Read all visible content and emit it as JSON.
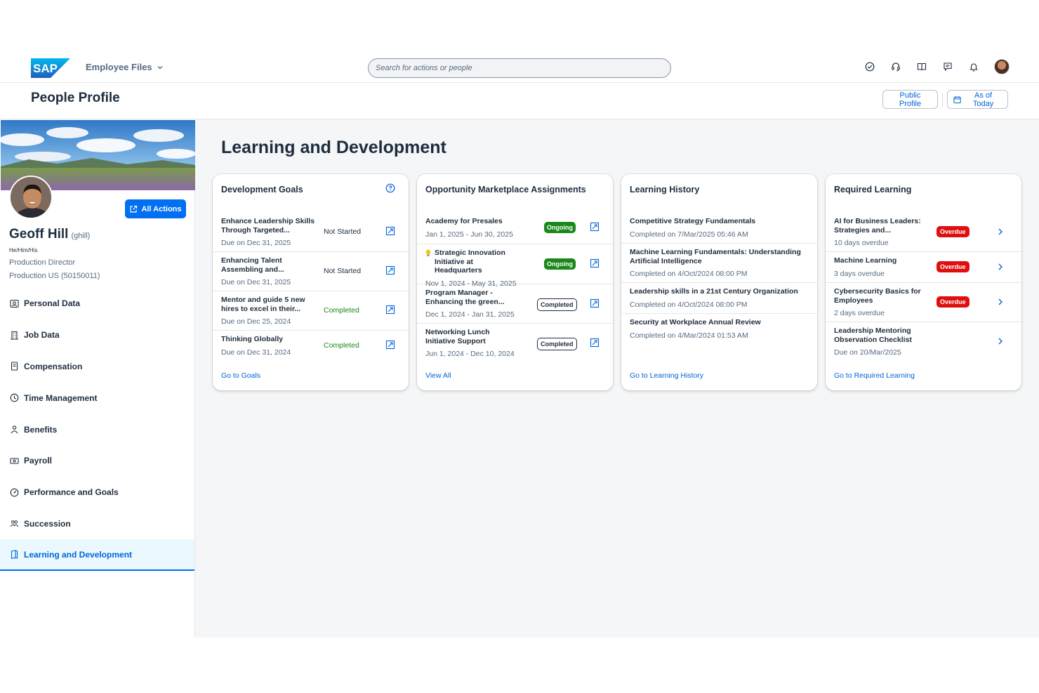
{
  "shell": {
    "product_name": "Employee Files",
    "search_placeholder": "Search for actions or people",
    "icons": [
      "checkmark-circle-icon",
      "headset-icon",
      "book-icon",
      "feedback-icon",
      "bell-icon",
      "user-avatar"
    ]
  },
  "page": {
    "title": "People Profile",
    "public_profile_label": "Public Profile",
    "as_of_today_label": "As of Today"
  },
  "profile": {
    "name": "Geoff Hill",
    "username": "(ghill)",
    "pronouns": "He/Him/His",
    "job_title": "Production Director",
    "department": "Production US (50150011)",
    "all_actions_label": "All Actions"
  },
  "nav": {
    "items": [
      {
        "label": "Personal Data",
        "icon": "personal-data-icon"
      },
      {
        "label": "Job Data",
        "icon": "building-icon"
      },
      {
        "label": "Compensation",
        "icon": "compensation-icon"
      },
      {
        "label": "Time Management",
        "icon": "time-icon"
      },
      {
        "label": "Benefits",
        "icon": "benefits-icon"
      },
      {
        "label": "Payroll",
        "icon": "payroll-icon"
      },
      {
        "label": "Performance and Goals",
        "icon": "performance-icon"
      },
      {
        "label": "Succession",
        "icon": "succession-icon"
      },
      {
        "label": "Learning and Development",
        "icon": "learning-icon",
        "active": true
      }
    ]
  },
  "main": {
    "section_title": "Learning and Development",
    "cards": {
      "goals": {
        "title": "Development Goals",
        "link": "Go to Goals",
        "rows": [
          {
            "title": "Enhance Leadership Skills Through Targeted...",
            "sub": "Due on Dec 31, 2025",
            "status": "Not Started"
          },
          {
            "title": "Enhancing Talent Assembling and...",
            "sub": "Due on Dec 31, 2025",
            "status": "Not Started"
          },
          {
            "title": "Mentor and guide 5 new hires to excel in their...",
            "sub": "Due on Dec 25, 2024",
            "status": "Completed"
          },
          {
            "title": "Thinking Globally",
            "sub": "Due on Dec 31, 2024",
            "status": "Completed"
          }
        ]
      },
      "opportunity": {
        "title": "Opportunity Marketplace Assignments",
        "link": "View All",
        "rows": [
          {
            "title": "Academy for Presales",
            "sub": "Jan 1, 2025 - Jun 30, 2025",
            "status": "Ongoing"
          },
          {
            "title": "Strategic Innovation Initiative at Headquarters",
            "sub": "Nov 1, 2024 - May 31, 2025",
            "status": "Ongoing",
            "icon": "lightbulb-icon"
          },
          {
            "title": "Program Manager - Enhancing the green...",
            "sub": "Dec 1, 2024 - Jan 31, 2025",
            "status": "Completed"
          },
          {
            "title": "Networking Lunch Initiative Support",
            "sub": "Jun 1, 2024 - Dec 10, 2024",
            "status": "Completed"
          }
        ]
      },
      "history": {
        "title": "Learning History",
        "link": "Go to Learning History",
        "rows": [
          {
            "title": "Competitive Strategy Fundamentals",
            "sub": "Completed on 7/Mar/2025 05:46 AM"
          },
          {
            "title": "Machine Learning Fundamentals: Understanding Artificial Intelligence",
            "sub": "Completed on 4/Oct/2024 08:00 PM"
          },
          {
            "title": "Leadership skills in a 21st Century Organization",
            "sub": "Completed on 4/Oct/2024 08:00 PM"
          },
          {
            "title": "Security at Workplace Annual Review",
            "sub": "Completed on 4/Mar/2024 01:53 AM"
          }
        ]
      },
      "required": {
        "title": "Required Learning",
        "link": "Go to Required Learning",
        "rows": [
          {
            "title": "AI for Business Leaders: Strategies and...",
            "sub": "10 days overdue",
            "status": "Overdue"
          },
          {
            "title": "Machine Learning",
            "sub": "3 days overdue",
            "status": "Overdue"
          },
          {
            "title": "Cybersecurity Basics for Employees",
            "sub": "2 days overdue",
            "status": "Overdue"
          },
          {
            "title": "Leadership Mentoring Observation Checklist",
            "sub": "Due on 20/Mar/2025"
          }
        ]
      }
    }
  },
  "colors": {
    "brand_blue": "#0070f2",
    "link_blue": "#0064d9",
    "success_green": "#188918",
    "error_red": "#e00f0f",
    "text": "#1d2d3e",
    "subtext": "#556b82"
  }
}
